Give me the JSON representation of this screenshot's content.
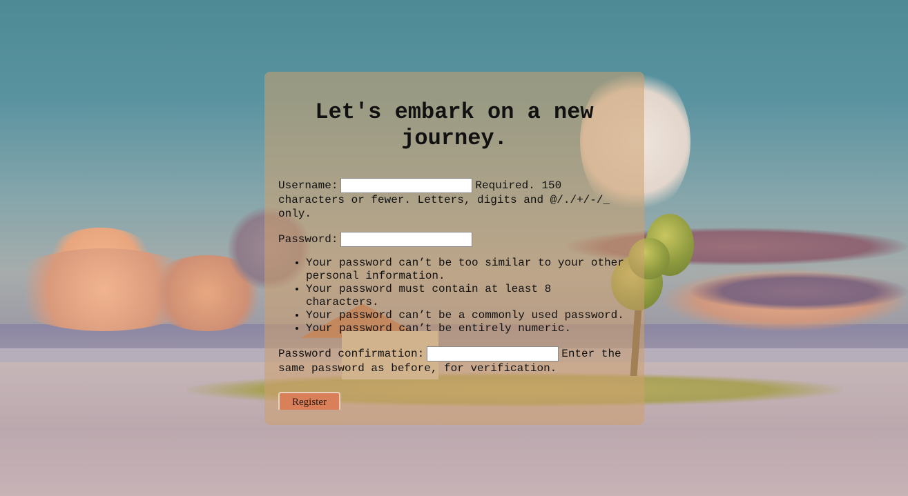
{
  "page": {
    "title": "Let's embark on a new journey."
  },
  "form": {
    "username": {
      "label": "Username:",
      "value": "",
      "help": "Required. 150 characters or fewer. Letters, digits and @/./+/-/_ only."
    },
    "password": {
      "label": "Password:",
      "value": "",
      "help_items": [
        "Your password can’t be too similar to your other personal information.",
        "Your password must contain at least 8 characters.",
        "Your password can’t be a commonly used password.",
        "Your password can’t be entirely numeric."
      ]
    },
    "password_confirmation": {
      "label": "Password confirmation:",
      "value": "",
      "help": "Enter the same password as before, for verification."
    },
    "submit_label": "Register"
  },
  "colors": {
    "card_background": "#cda06e",
    "button_background": "#d9805a"
  }
}
